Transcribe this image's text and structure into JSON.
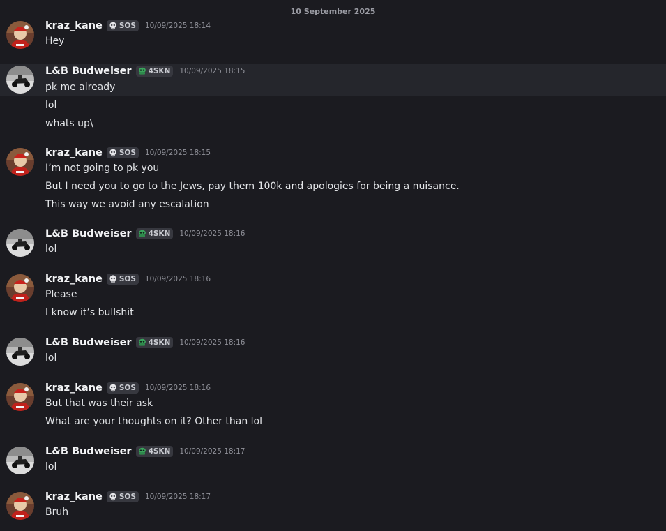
{
  "date_divider": "10 September 2025",
  "users": {
    "kraz": {
      "name": "kraz_kane",
      "tag": "SOS",
      "tag_icon": "skull-icon"
    },
    "lb": {
      "name": "L&B Budweiser",
      "tag": "4SKN",
      "tag_icon": "alien-icon"
    }
  },
  "colors": {
    "background": "#1b1b20",
    "highlight": "#25262c",
    "tag_green": "#3ba55d"
  },
  "groups": [
    {
      "user": "kraz_kane",
      "tag": "SOS",
      "time": "10/09/2025 18:14",
      "lines": [
        "Hey"
      ]
    },
    {
      "user": "L&B Budweiser",
      "tag": "4SKN",
      "time": "10/09/2025 18:15",
      "lines": [
        "pk me already",
        "lol",
        "whats up\\"
      ]
    },
    {
      "user": "kraz_kane",
      "tag": "SOS",
      "time": "10/09/2025 18:15",
      "lines": [
        "I’m not going to pk you",
        "But I need you to go to the Jews, pay them 100k and apologies for being a nuisance.",
        "This way we avoid any escalation"
      ]
    },
    {
      "user": "L&B Budweiser",
      "tag": "4SKN",
      "time": "10/09/2025 18:16",
      "lines": [
        "lol"
      ]
    },
    {
      "user": "kraz_kane",
      "tag": "SOS",
      "time": "10/09/2025 18:16",
      "lines": [
        "Please",
        "I know it’s bullshit"
      ]
    },
    {
      "user": "L&B Budweiser",
      "tag": "4SKN",
      "time": "10/09/2025 18:16",
      "lines": [
        "lol"
      ]
    },
    {
      "user": "kraz_kane",
      "tag": "SOS",
      "time": "10/09/2025 18:16",
      "lines": [
        "But that was their ask",
        "What are your thoughts on it? Other than lol"
      ]
    },
    {
      "user": "L&B Budweiser",
      "tag": "4SKN",
      "time": "10/09/2025 18:17",
      "lines": [
        "lol"
      ]
    },
    {
      "user": "kraz_kane",
      "tag": "SOS",
      "time": "10/09/2025 18:17",
      "lines": [
        "Bruh"
      ]
    }
  ]
}
